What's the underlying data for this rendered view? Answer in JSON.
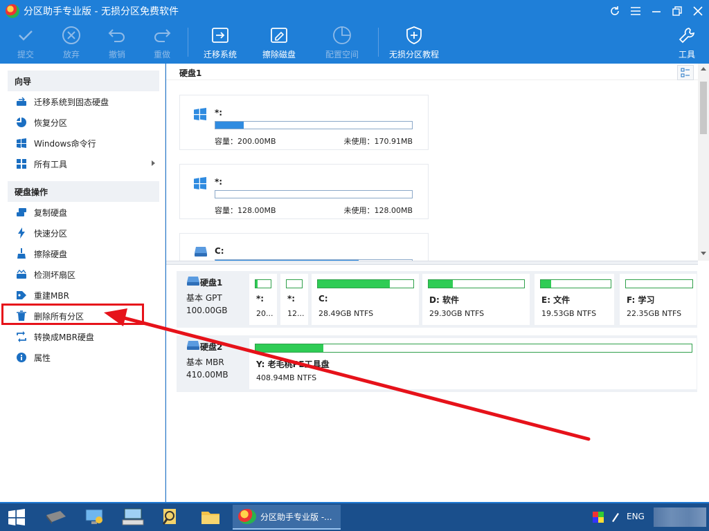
{
  "window": {
    "title": "分区助手专业版 - 无损分区免费软件",
    "controls": {
      "refresh_icon": "refresh-icon",
      "menu_icon": "menu-icon",
      "minimize_icon": "minimize-icon",
      "restore_icon": "restore-icon",
      "close_icon": "close-icon"
    }
  },
  "toolbar": {
    "commit": "提交",
    "discard": "放弃",
    "undo": "撤销",
    "redo": "重做",
    "migrate_os": "迁移系统",
    "wipe_disk": "擦除磁盘",
    "allocate_space": "配置空间",
    "tutorial": "无损分区教程",
    "tools": "工具"
  },
  "sidebar": {
    "wizard": {
      "header": "向导",
      "items": [
        {
          "label": "迁移系统到固态硬盘",
          "icon": "migrate-ssd-icon"
        },
        {
          "label": "恢复分区",
          "icon": "recover-partition-icon"
        },
        {
          "label": "Windows命令行",
          "icon": "windows-icon"
        },
        {
          "label": "所有工具",
          "icon": "all-tools-icon"
        }
      ]
    },
    "disk_ops": {
      "header": "硬盘操作",
      "items": [
        {
          "label": "复制硬盘",
          "icon": "copy-disk-icon"
        },
        {
          "label": "快速分区",
          "icon": "quick-partition-icon"
        },
        {
          "label": "擦除硬盘",
          "icon": "wipe-disk-icon"
        },
        {
          "label": "检测坏扇区",
          "icon": "bad-sector-icon"
        },
        {
          "label": "重建MBR",
          "icon": "rebuild-mbr-icon"
        },
        {
          "label": "删除所有分区",
          "icon": "trash-icon"
        },
        {
          "label": "转换成MBR硬盘",
          "icon": "convert-icon"
        },
        {
          "label": "属性",
          "icon": "info-icon"
        }
      ]
    }
  },
  "disk_panel": {
    "header": "硬盘1",
    "cards": [
      {
        "name": "*:",
        "capacity": "容量：200.00MB",
        "free": "未使用：170.91MB",
        "used_fraction": 0.145
      },
      {
        "name": "*:",
        "capacity": "容量：128.00MB",
        "free": "未使用：128.00MB",
        "used_fraction": 0.0
      },
      {
        "name": "C:",
        "capacity": "",
        "free": "",
        "used_fraction": 0.73
      }
    ]
  },
  "disk_map": [
    {
      "name": "硬盘1",
      "type": "基本 GPT",
      "size": "100.00GB",
      "partitions": [
        {
          "name": "*:",
          "size": "20...",
          "used_fraction": 0.15
        },
        {
          "name": "*:",
          "size": "12...",
          "used_fraction": 0.0
        },
        {
          "name": "C:",
          "size": "28.49GB NTFS",
          "used_fraction": 0.75
        },
        {
          "name": "D: 软件",
          "size": "29.30GB NTFS",
          "used_fraction": 0.25
        },
        {
          "name": "E: 文件",
          "size": "19.53GB NTFS",
          "used_fraction": 0.15
        },
        {
          "name": "F: 学习",
          "size": "22.35GB NTFS",
          "used_fraction": 0.0
        }
      ]
    },
    {
      "name": "硬盘2",
      "type": "基本 MBR",
      "size": "410.00MB",
      "partitions": [
        {
          "name": "Y: 老毛桃PE工具盘",
          "size": "408.94MB NTFS",
          "used_fraction": 0.155
        }
      ]
    }
  ],
  "taskbar": {
    "active_app": "分区助手专业版 -...",
    "lang": "ENG"
  },
  "colors": {
    "accent": "#1f7fd8",
    "used_green": "#2fcc55",
    "used_blue": "#2f8be0",
    "annotation_red": "#e6121a"
  }
}
